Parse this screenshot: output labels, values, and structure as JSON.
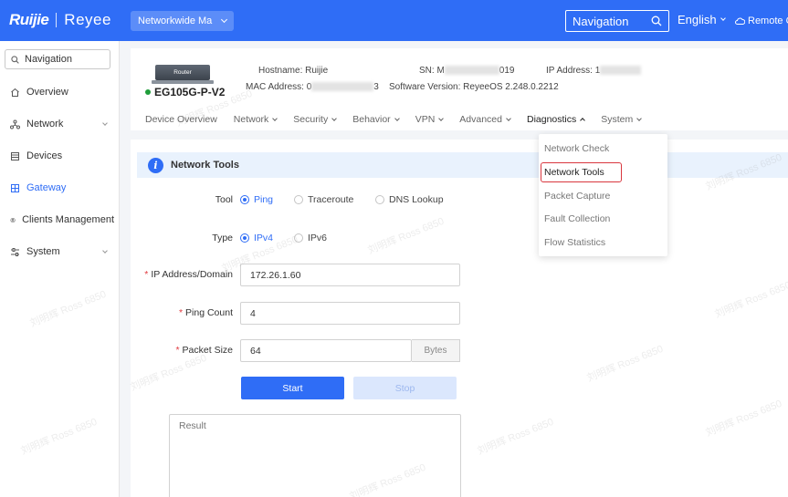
{
  "header": {
    "brand_primary": "Ruijie",
    "brand_secondary": "Reyee",
    "project_select": "Networkwide Ma",
    "search_label": "Navigation",
    "language": "English",
    "remote_label": "Remote C"
  },
  "sidebar": {
    "search_label": "Navigation",
    "items": [
      {
        "label": "Overview",
        "icon": "home-icon"
      },
      {
        "label": "Network",
        "icon": "network-icon"
      },
      {
        "label": "Devices",
        "icon": "devices-icon"
      },
      {
        "label": "Gateway",
        "icon": "gateway-icon"
      },
      {
        "label": "Clients Management",
        "icon": "clients-icon"
      },
      {
        "label": "System",
        "icon": "settings-icon"
      }
    ]
  },
  "device": {
    "icon_label": "Router",
    "model": "EG105G-P-V2",
    "hostname_label": "Hostname:",
    "hostname_value": "Ruijie",
    "sn_label": "SN:",
    "sn_prefix": "M",
    "sn_suffix": "019",
    "ip_label": "IP Address:",
    "ip_prefix": "1",
    "mac_label": "MAC Address:",
    "mac_prefix": "0",
    "mac_suffix": "3",
    "software_label": "Software Version:",
    "software_value": "ReyeeOS 2.248.0.2212"
  },
  "tabs": [
    {
      "label": "Device Overview"
    },
    {
      "label": "Network"
    },
    {
      "label": "Security"
    },
    {
      "label": "Behavior"
    },
    {
      "label": "VPN"
    },
    {
      "label": "Advanced"
    },
    {
      "label": "Diagnostics"
    },
    {
      "label": "System"
    }
  ],
  "diagnostics_menu": [
    "Network Check",
    "Network Tools",
    "Packet Capture",
    "Fault Collection",
    "Flow Statistics"
  ],
  "network_tools": {
    "title": "Network Tools",
    "tool_label": "Tool",
    "tool_options": [
      "Ping",
      "Traceroute",
      "DNS Lookup"
    ],
    "tool_selected": "Ping",
    "type_label": "Type",
    "type_options": [
      "IPv4",
      "IPv6"
    ],
    "type_selected": "IPv4",
    "ip_label": "IP Address/Domain",
    "ip_value": "172.26.1.60",
    "count_label": "Ping Count",
    "count_value": "4",
    "size_label": "Packet Size",
    "size_value": "64",
    "size_unit": "Bytes",
    "start_label": "Start",
    "stop_label": "Stop",
    "result_placeholder": "Result"
  },
  "watermark": "刘明辉 Ross 6850",
  "colors": {
    "primary": "#2f6df6",
    "highlight_box": "#d9363e",
    "status_online": "#1f9d3a"
  }
}
